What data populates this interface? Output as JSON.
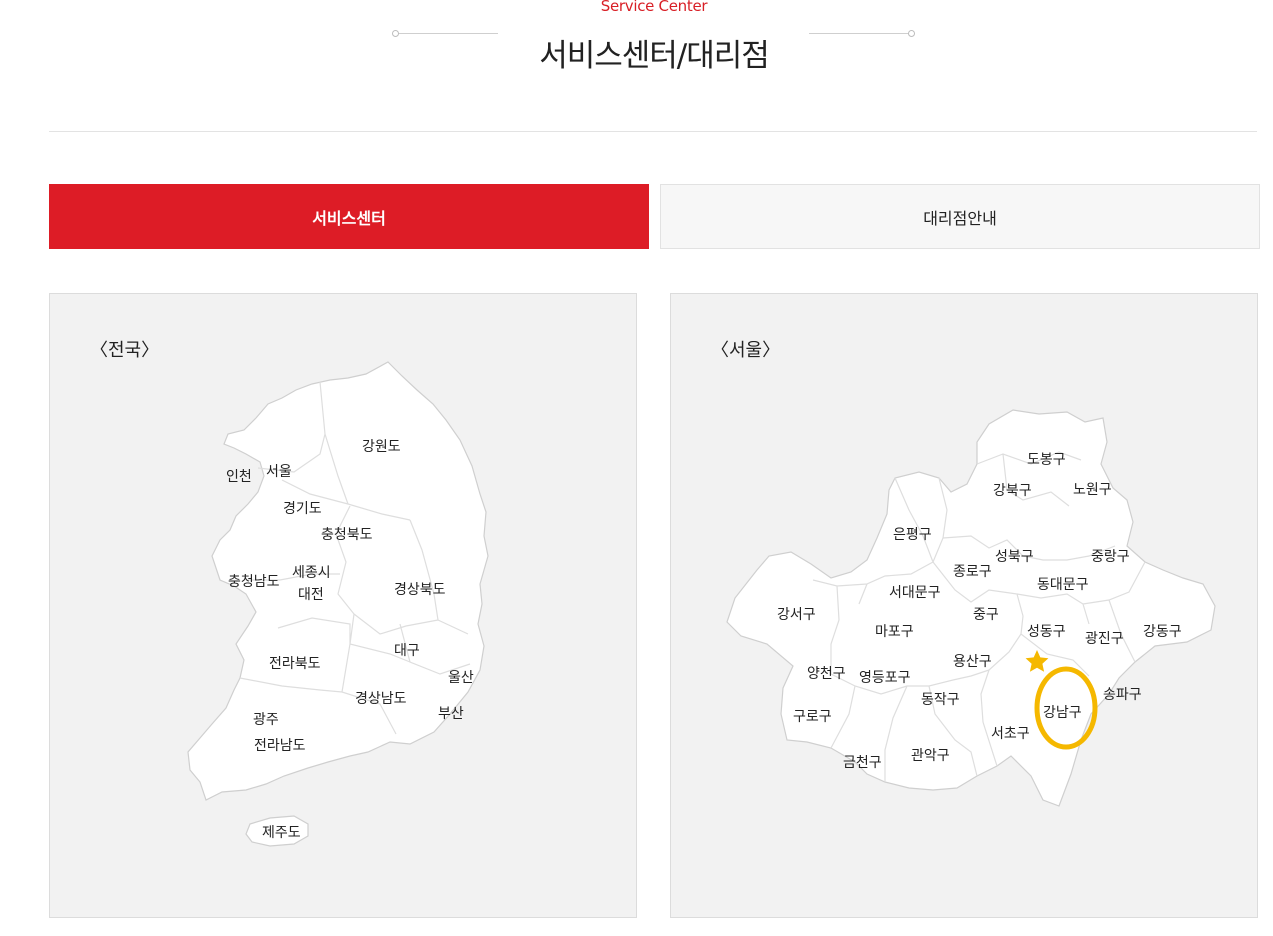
{
  "header": {
    "subtitle": "Service Center",
    "title": "서비스센터/대리점"
  },
  "tabs": [
    {
      "label": "서비스센터",
      "active": true
    },
    {
      "label": "대리점안내",
      "active": false
    }
  ],
  "accent_color": "#dd1c26",
  "highlight_color": "#f5b800",
  "national_map": {
    "label": "〈전국〉",
    "regions": [
      "강원도",
      "인천",
      "서울",
      "경기도",
      "충청북도",
      "충청남도",
      "세종시",
      "대전",
      "경상북도",
      "대구",
      "전라북도",
      "울산",
      "경상남도",
      "부산",
      "광주",
      "전라남도",
      "제주도"
    ]
  },
  "seoul_map": {
    "label": "〈서울〉",
    "districts": [
      "도봉구",
      "강북구",
      "노원구",
      "은평구",
      "성북구",
      "중랑구",
      "종로구",
      "서대문구",
      "동대문구",
      "강서구",
      "중구",
      "마포구",
      "성동구",
      "광진구",
      "강동구",
      "용산구",
      "양천구",
      "영등포구",
      "송파구",
      "강남구",
      "동작구",
      "구로구",
      "서초구",
      "관악구",
      "금천구"
    ],
    "highlighted_district": "강남구",
    "marker_icon": "star-icon"
  }
}
